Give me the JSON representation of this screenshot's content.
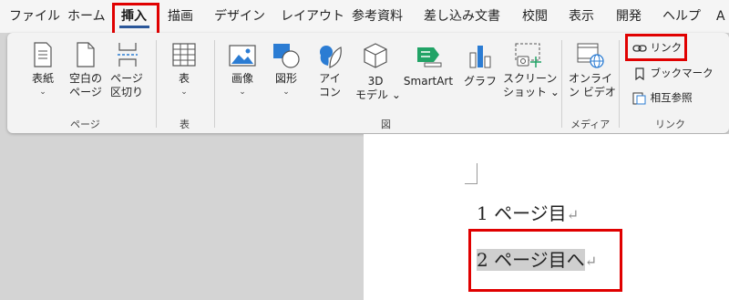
{
  "tabs": [
    {
      "label": "ファイル"
    },
    {
      "label": "ホーム"
    },
    {
      "label": "挿入"
    },
    {
      "label": "描画"
    },
    {
      "label": "デザイン"
    },
    {
      "label": "レイアウト"
    },
    {
      "label": "参考資料"
    },
    {
      "label": "差し込み文書"
    },
    {
      "label": "校閲"
    },
    {
      "label": "表示"
    },
    {
      "label": "開発"
    },
    {
      "label": "ヘルプ"
    },
    {
      "label": "A"
    }
  ],
  "ribbon": {
    "pages": {
      "cover": {
        "line1": "表紙",
        "line2": "⌄"
      },
      "blank": {
        "line1": "空白の",
        "line2": "ページ"
      },
      "break": {
        "line1": "ページ",
        "line2": "区切り"
      },
      "label": "ページ"
    },
    "tables": {
      "table": {
        "line1": "表",
        "line2": "⌄"
      },
      "label": "表"
    },
    "illustrations": {
      "picture": {
        "line1": "画像",
        "line2": "⌄"
      },
      "shapes": {
        "line1": "図形",
        "line2": "⌄"
      },
      "icons": {
        "line1": "アイ",
        "line2": "コン"
      },
      "model3d": {
        "line1": "3D",
        "line2": "モデル ⌄"
      },
      "smartart": {
        "line1": "SmartArt"
      },
      "chart": {
        "line1": "グラフ"
      },
      "screenshot": {
        "line1": "スクリーン",
        "line2": "ショット ⌄"
      },
      "label": "図"
    },
    "media": {
      "online_video": {
        "line1": "オンライ",
        "line2": "ン ビデオ"
      },
      "label": "メディア"
    },
    "links": {
      "link": "リンク",
      "bookmark": "ブックマーク",
      "crossref": "相互参照",
      "label": "リンク"
    }
  },
  "document": {
    "line1": "1 ページ目",
    "line2": "2 ページ目へ",
    "return_mark": "↵"
  },
  "colors": {
    "highlight_box": "#e00000",
    "active_tab_underline": "#2b579a"
  }
}
